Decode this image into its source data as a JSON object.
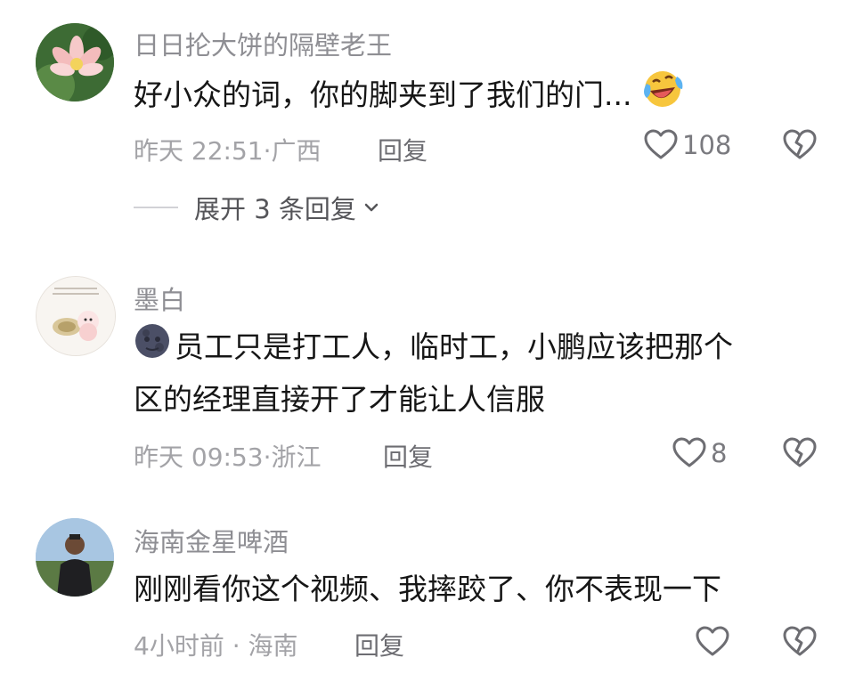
{
  "comments": [
    {
      "username": "日日抡大饼的隔壁老王",
      "text": "好小众的词，你的脚夹到了我们的门...",
      "emoji": "laughing-crying-emoji",
      "time": "昨天 22:51·",
      "location": "广西",
      "reply_label": "回复",
      "likes": "108",
      "expand_label": "展开 3 条回复"
    },
    {
      "username": "墨白",
      "emoji": "new-moon-face-emoji",
      "text_line1": "员工只是打工人，临时工，小鹏应该把那个",
      "text_line2": "区的经理直接开了才能让人信服",
      "time": "昨天 09:53·",
      "location": "浙江",
      "reply_label": "回复",
      "likes": "8"
    },
    {
      "username": "海南金星啤酒",
      "text": "刚刚看你这个视频、我摔跤了、你不表现一下",
      "time": "4小时前 ·",
      "location": "海南",
      "reply_label": "回复",
      "likes": ""
    }
  ],
  "colors": {
    "username": "#8e8e93",
    "text": "#161616",
    "meta": "#a3a3a7",
    "icon": "#6d6d72"
  }
}
